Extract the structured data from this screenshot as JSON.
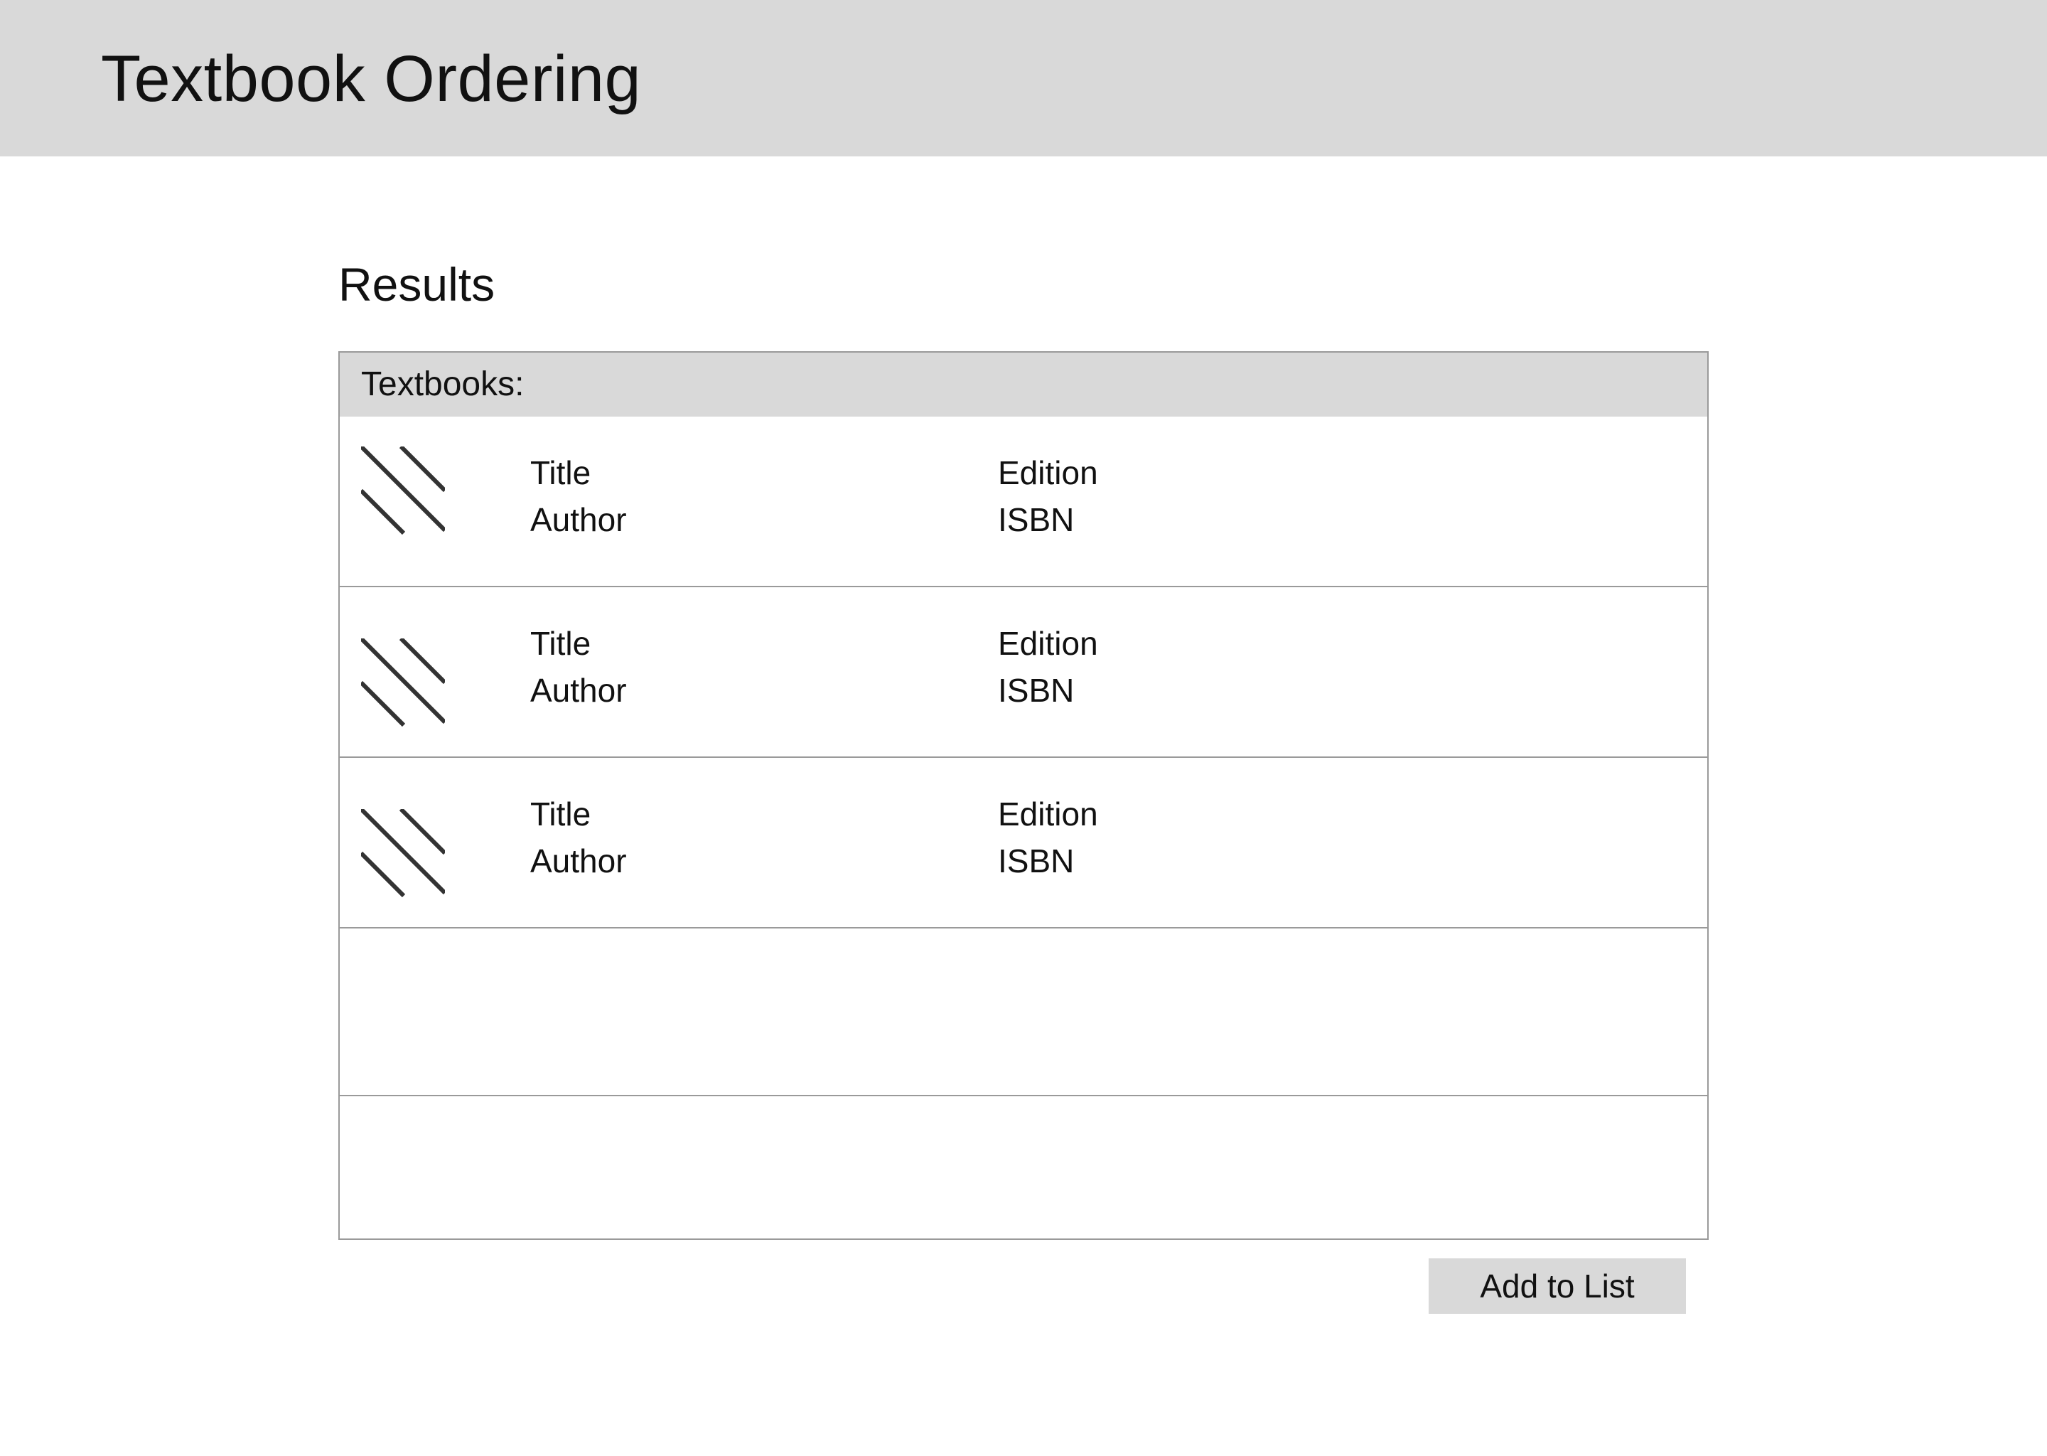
{
  "app": {
    "title": "Textbook Ordering"
  },
  "results": {
    "heading": "Results",
    "panel_label": "Textbooks:",
    "items": [
      {
        "thumbnail_icon": "image-placeholder-icon",
        "title": "Title",
        "author": "Author",
        "edition": "Edition",
        "isbn": "ISBN"
      },
      {
        "thumbnail_icon": "image-placeholder-icon",
        "title": "Title",
        "author": "Author",
        "edition": "Edition",
        "isbn": "ISBN"
      },
      {
        "thumbnail_icon": "image-placeholder-icon",
        "title": "Title",
        "author": "Author",
        "edition": "Edition",
        "isbn": "ISBN"
      }
    ]
  },
  "actions": {
    "add_label": "Add to List"
  },
  "colors": {
    "header_bg": "#d9d9d9",
    "panel_border": "#9a9a9a",
    "icon_stroke": "#333333",
    "text": "#111111"
  }
}
